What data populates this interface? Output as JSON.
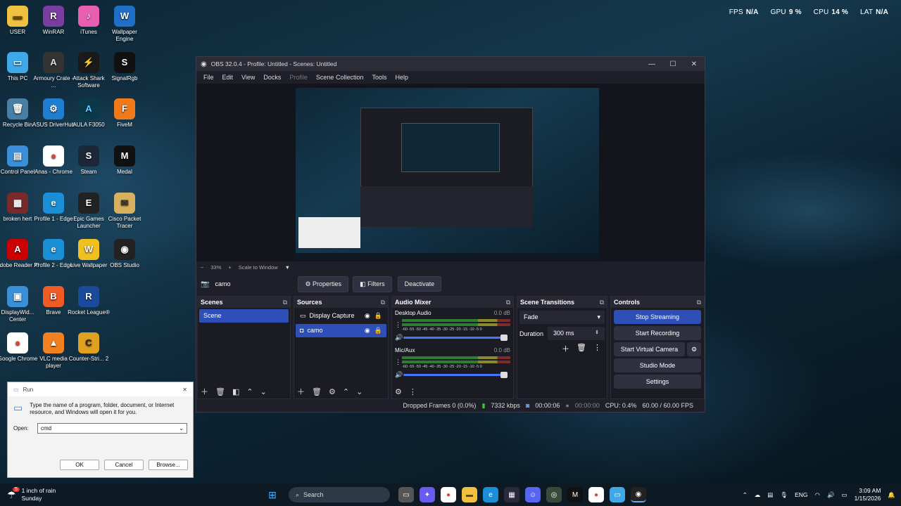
{
  "desktop": {
    "icons": [
      {
        "label": "USER",
        "glyph": "▬",
        "bg": "#f0c040",
        "fg": "#6b4a00",
        "col": 0,
        "row": 0
      },
      {
        "label": "WinRAR",
        "glyph": "R",
        "bg": "#7a3ea0",
        "fg": "#fff",
        "col": 1,
        "row": 0
      },
      {
        "label": "iTunes",
        "glyph": "♪",
        "bg": "#e85fb0",
        "fg": "#fff",
        "col": 2,
        "row": 0
      },
      {
        "label": "Wallpaper Engine",
        "glyph": "W",
        "bg": "#1f6fc9",
        "fg": "#fff",
        "col": 3,
        "row": 0
      },
      {
        "label": "This PC",
        "glyph": "▭",
        "bg": "#3fa9e8",
        "fg": "#fff",
        "col": 0,
        "row": 1
      },
      {
        "label": "Armoury Crate - ...",
        "glyph": "A",
        "bg": "#333",
        "fg": "#ddd",
        "col": 1,
        "row": 1
      },
      {
        "label": "Attack Shark Software",
        "glyph": "⚡",
        "bg": "#1a1a1a",
        "fg": "#f0c000",
        "col": 2,
        "row": 1
      },
      {
        "label": "SignalRgb",
        "glyph": "S",
        "bg": "#111",
        "fg": "#fff",
        "col": 3,
        "row": 1
      },
      {
        "label": "Recycle Bin",
        "glyph": "🗑",
        "bg": "#4a7fa5",
        "fg": "#fff",
        "col": 0,
        "row": 2
      },
      {
        "label": "ASUS DriverHub",
        "glyph": "⚙",
        "bg": "#1e7fd0",
        "fg": "#fff",
        "col": 1,
        "row": 2
      },
      {
        "label": "AULA F3050",
        "glyph": "A",
        "bg": "#0a3a4a",
        "fg": "#6cf",
        "col": 2,
        "row": 2
      },
      {
        "label": "FiveM",
        "glyph": "F",
        "bg": "#f07a1a",
        "fg": "#fff",
        "col": 3,
        "row": 2
      },
      {
        "label": "Control Panel",
        "glyph": "▤",
        "bg": "#3b8ed8",
        "fg": "#fff",
        "col": 0,
        "row": 3
      },
      {
        "label": "Anas - Chrome",
        "glyph": "●",
        "bg": "#fff",
        "fg": "#db4437",
        "col": 1,
        "row": 3
      },
      {
        "label": "Steam",
        "glyph": "S",
        "bg": "#1b2838",
        "fg": "#fff",
        "col": 2,
        "row": 3
      },
      {
        "label": "Medal",
        "glyph": "M",
        "bg": "#111",
        "fg": "#fff",
        "col": 3,
        "row": 3
      },
      {
        "label": "broken hert",
        "glyph": "▦",
        "bg": "#7a2a2a",
        "fg": "#fff",
        "col": 0,
        "row": 4
      },
      {
        "label": "Profile 1 - Edge",
        "glyph": "e",
        "bg": "#1a8fd8",
        "fg": "#fff",
        "col": 1,
        "row": 4
      },
      {
        "label": "Epic Games Launcher",
        "glyph": "E",
        "bg": "#222",
        "fg": "#fff",
        "col": 2,
        "row": 4
      },
      {
        "label": "Cisco Packet Tracer",
        "glyph": "✉",
        "bg": "#d8b060",
        "fg": "#333",
        "col": 3,
        "row": 4
      },
      {
        "label": "Adobe Reader XI",
        "glyph": "A",
        "bg": "#c00",
        "fg": "#fff",
        "col": 0,
        "row": 5
      },
      {
        "label": "Profile 2 - Edge",
        "glyph": "e",
        "bg": "#1a8fd8",
        "fg": "#fff",
        "col": 1,
        "row": 5
      },
      {
        "label": "Live Wallpaper",
        "glyph": "W",
        "bg": "#f0c020",
        "fg": "#fff",
        "col": 2,
        "row": 5
      },
      {
        "label": "OBS Studio",
        "glyph": "◉",
        "bg": "#222",
        "fg": "#fff",
        "col": 3,
        "row": 5
      },
      {
        "label": "DisplayWid... Center",
        "glyph": "▣",
        "bg": "#3b8ed8",
        "fg": "#fff",
        "col": 0,
        "row": 6
      },
      {
        "label": "Brave",
        "glyph": "B",
        "bg": "#f05a24",
        "fg": "#fff",
        "col": 1,
        "row": 6
      },
      {
        "label": "Rocket League®",
        "glyph": "R",
        "bg": "#1a4a9a",
        "fg": "#fff",
        "col": 2,
        "row": 6
      },
      {
        "label": "Google Chrome",
        "glyph": "●",
        "bg": "#fff",
        "fg": "#db4437",
        "col": 0,
        "row": 7
      },
      {
        "label": "VLC media player",
        "glyph": "▲",
        "bg": "#f08020",
        "fg": "#fff",
        "col": 1,
        "row": 7
      },
      {
        "label": "Counter-Stri... 2",
        "glyph": "C",
        "bg": "#e0a020",
        "fg": "#222",
        "col": 2,
        "row": 7
      }
    ]
  },
  "perf": {
    "fps_label": "FPS",
    "fps": "N/A",
    "gpu_label": "GPU",
    "gpu": "9 %",
    "cpu_label": "CPU",
    "cpu": "14 %",
    "lat_label": "LAT",
    "lat": "N/A"
  },
  "obs": {
    "title": "OBS 32.0.4 - Profile: Untitled - Scenes: Untitled",
    "menu": [
      "File",
      "Edit",
      "View",
      "Docks",
      "Profile",
      "Scene Collection",
      "Tools",
      "Help"
    ],
    "zoom": "33%",
    "scale_mode": "Scale to Window",
    "source_name": "camo",
    "properties_label": "Properties",
    "filters_label": "Filters",
    "deactivate_label": "Deactivate",
    "scenes_title": "Scenes",
    "scenes": [
      "Scene"
    ],
    "sources_title": "Sources",
    "sources": [
      {
        "name": "Display Capture",
        "icon": "display-icon"
      },
      {
        "name": "camo",
        "icon": "camera-icon"
      }
    ],
    "audio_title": "Audio Mixer",
    "audio": [
      {
        "name": "Desktop Audio",
        "db": "0.0 dB"
      },
      {
        "name": "Mic/Aux",
        "db": "0.0 dB"
      }
    ],
    "meter_ticks": "-60 -55 -50 -45 -40 -35 -30 -25 -20 -15 -10 -5 0",
    "transitions_title": "Scene Transitions",
    "transition": "Fade",
    "duration_label": "Duration",
    "duration": "300 ms",
    "controls_title": "Controls",
    "controls": [
      "Stop Streaming",
      "Start Recording",
      "Start Virtual Camera",
      "Studio Mode",
      "Settings"
    ],
    "status": {
      "dropped": "Dropped Frames 0 (0.0%)",
      "kbps": "7332 kbps",
      "stream_time": "00:00:06",
      "rec_time": "00:00:00",
      "cpu": "CPU: 0.4%",
      "fps": "60.00 / 60.00 FPS"
    }
  },
  "run": {
    "title": "Run",
    "description": "Type the name of a program, folder, document, or Internet resource, and Windows will open it for you.",
    "open_label": "Open:",
    "value": "cmd",
    "ok": "OK",
    "cancel": "Cancel",
    "browse": "Browse..."
  },
  "taskbar": {
    "weather": "1 inch of rain",
    "weather_sub": "Sunday",
    "weather_badge": "5",
    "search": "Search",
    "lang": "ENG",
    "time": "3:09 AM",
    "date": "1/15/2026"
  }
}
